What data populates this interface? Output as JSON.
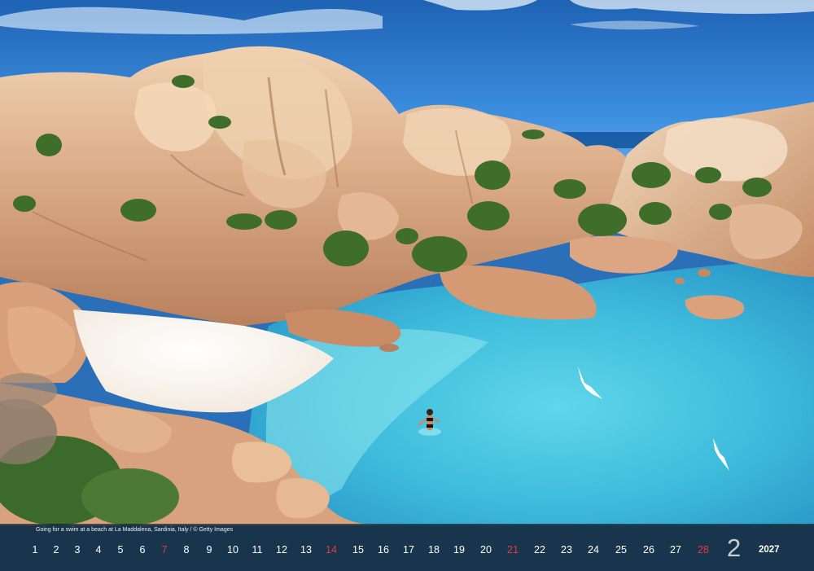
{
  "scene": {
    "description_icon": "photo-landscape"
  },
  "calendar": {
    "caption": "Going for a swim at a beach at La Maddalena, Sardinia, Italy / © Getty Images",
    "days": [
      {
        "n": "1",
        "sun": false
      },
      {
        "n": "2",
        "sun": false
      },
      {
        "n": "3",
        "sun": false
      },
      {
        "n": "4",
        "sun": false
      },
      {
        "n": "5",
        "sun": false
      },
      {
        "n": "6",
        "sun": false
      },
      {
        "n": "7",
        "sun": true
      },
      {
        "n": "8",
        "sun": false
      },
      {
        "n": "9",
        "sun": false
      },
      {
        "n": "10",
        "sun": false
      },
      {
        "n": "11",
        "sun": false
      },
      {
        "n": "12",
        "sun": false
      },
      {
        "n": "13",
        "sun": false
      },
      {
        "n": "14",
        "sun": true
      },
      {
        "n": "15",
        "sun": false
      },
      {
        "n": "16",
        "sun": false
      },
      {
        "n": "17",
        "sun": false
      },
      {
        "n": "18",
        "sun": false
      },
      {
        "n": "19",
        "sun": false
      },
      {
        "n": "20",
        "sun": false
      },
      {
        "n": "21",
        "sun": true
      },
      {
        "n": "22",
        "sun": false
      },
      {
        "n": "23",
        "sun": false
      },
      {
        "n": "24",
        "sun": false
      },
      {
        "n": "25",
        "sun": false
      },
      {
        "n": "26",
        "sun": false
      },
      {
        "n": "27",
        "sun": false
      },
      {
        "n": "28",
        "sun": true
      }
    ],
    "month": "2",
    "year": "2027",
    "sunday_color": "#e8393f"
  }
}
